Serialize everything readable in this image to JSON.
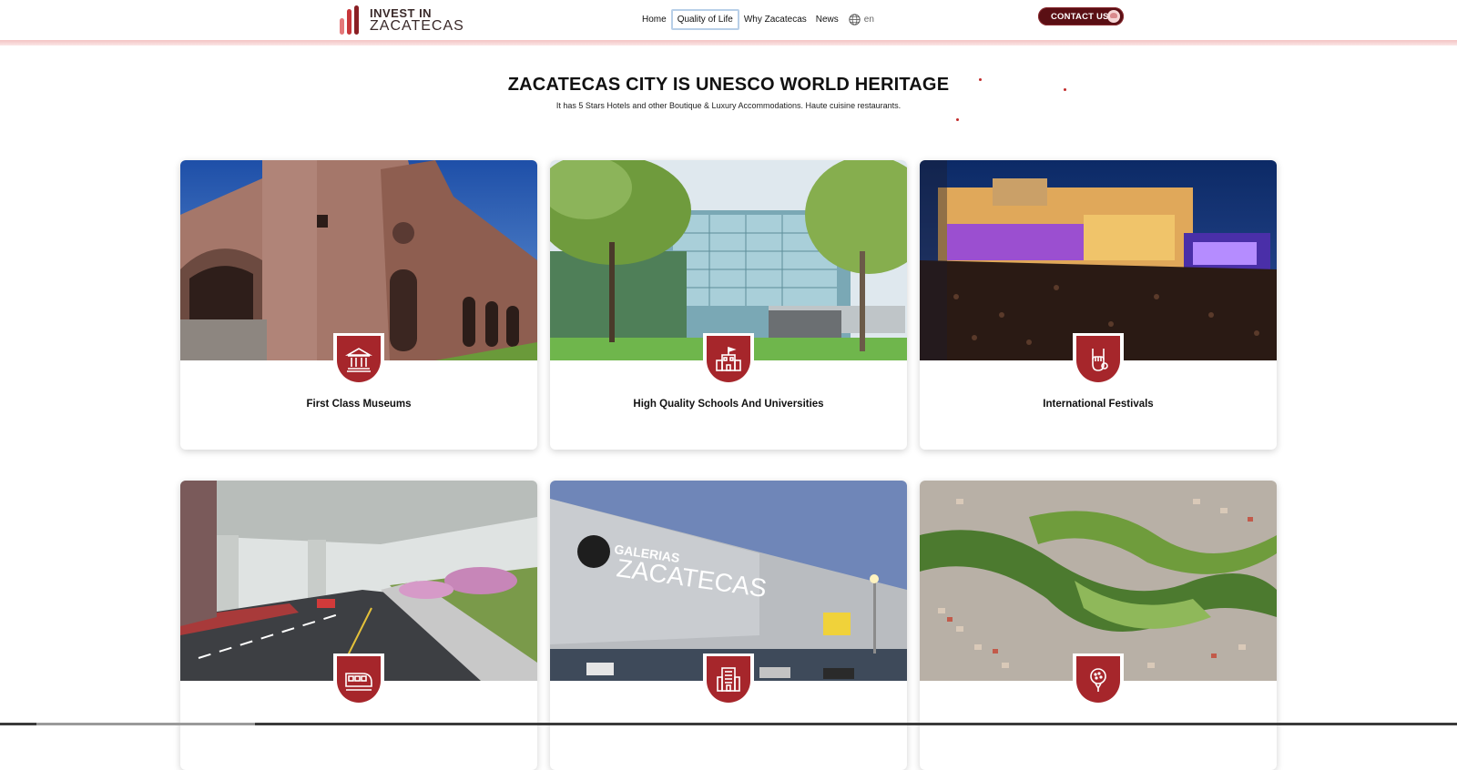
{
  "header": {
    "logo_line1": "INVEST IN",
    "logo_line2": "ZACATECAS",
    "nav": [
      {
        "label": "Home"
      },
      {
        "label": "Quality of Life",
        "active": true
      },
      {
        "label": "Why Zacatecas"
      },
      {
        "label": "News"
      }
    ],
    "language": "en",
    "contact_label": "CONTACT US"
  },
  "hero": {
    "title": "ZACATECAS CITY IS UNESCO WORLD HERITAGE",
    "subtitle": "It has 5 Stars Hotels and other Boutique & Luxury Accommodations. Haute cuisine restaurants."
  },
  "cards": [
    {
      "title": "First Class Museums",
      "icon": "museum-icon"
    },
    {
      "title": "High Quality Schools And Universities",
      "icon": "school-icon"
    },
    {
      "title": "International Festivals",
      "icon": "rock-hand-icon"
    },
    {
      "title": "",
      "icon": "train-icon"
    },
    {
      "title": "",
      "icon": "building-icon"
    },
    {
      "title": "",
      "icon": "golf-icon"
    }
  ],
  "colors": {
    "brand": "#a6262b",
    "brand_dark": "#5a0f14",
    "accent_line": "#f3c3c3"
  }
}
